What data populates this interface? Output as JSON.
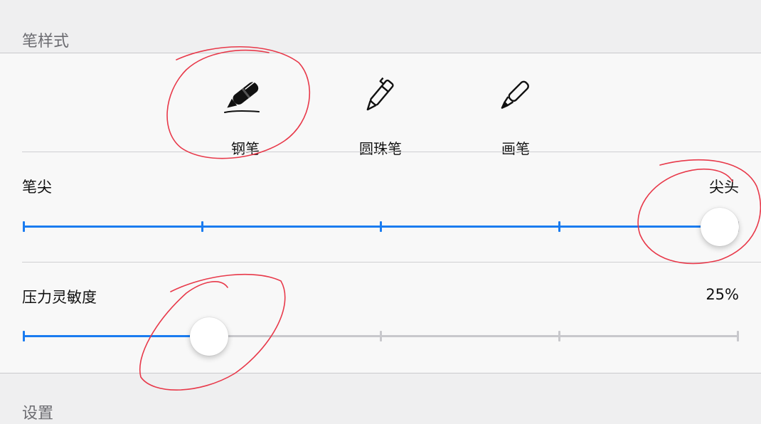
{
  "sections": {
    "pen_style_header": "笔样式",
    "settings_header": "设置"
  },
  "pen_types": [
    {
      "id": "fountain",
      "label": "钢笔",
      "icon": "fountain-pen-icon",
      "selected": true
    },
    {
      "id": "ballpoint",
      "label": "圆珠笔",
      "icon": "ballpoint-pen-icon",
      "selected": false
    },
    {
      "id": "marker",
      "label": "画笔",
      "icon": "marker-pen-icon",
      "selected": false
    }
  ],
  "nib": {
    "label": "笔尖",
    "value_label": "尖头",
    "steps": 5,
    "value_fraction": 0.975
  },
  "pressure": {
    "label": "压力灵敏度",
    "value_label": "25%",
    "steps": 5,
    "value_fraction": 0.26
  },
  "colors": {
    "accent": "#1a7cf0",
    "annotation": "#e8394a",
    "track_inactive": "#c8c8cc"
  }
}
